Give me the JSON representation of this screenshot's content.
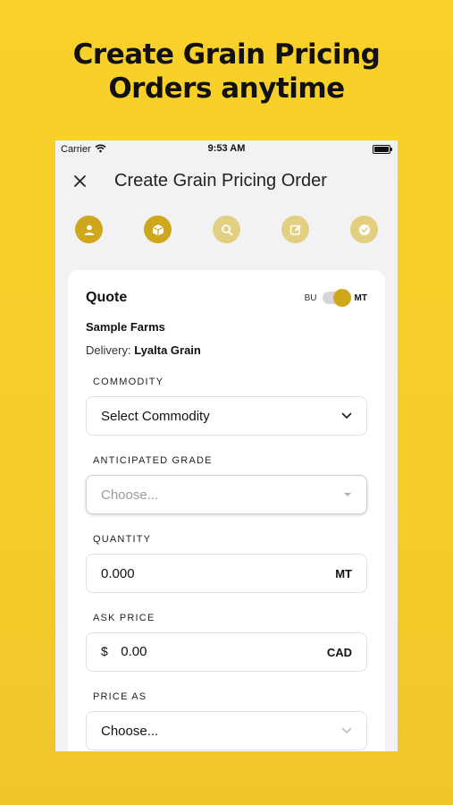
{
  "headline": {
    "line1": "Create Grain Pricing",
    "line2": "Orders anytime"
  },
  "status_bar": {
    "carrier": "Carrier",
    "time": "9:53 AM"
  },
  "navbar": {
    "title": "Create Grain Pricing Order",
    "close_icon": "close-icon"
  },
  "steps": [
    {
      "icon": "user-icon",
      "state": "active"
    },
    {
      "icon": "box-icon",
      "state": "active"
    },
    {
      "icon": "search-icon",
      "state": "inactive"
    },
    {
      "icon": "edit-icon",
      "state": "inactive"
    },
    {
      "icon": "check-circle-icon",
      "state": "inactive"
    }
  ],
  "quote": {
    "title": "Quote",
    "unit_left": "BU",
    "unit_right": "MT",
    "selected_unit": "MT",
    "farm": "Sample Farms",
    "delivery_label": "Delivery:",
    "delivery_value": "Lyalta Grain"
  },
  "form": {
    "commodity": {
      "label": "COMMODITY",
      "value": "Select Commodity"
    },
    "grade": {
      "label": "ANTICIPATED GRADE",
      "placeholder": "Choose..."
    },
    "quantity": {
      "label": "QUANTITY",
      "value": "0.000",
      "unit": "MT"
    },
    "ask_price": {
      "label": "ASK PRICE",
      "prefix": "$",
      "value": "0.00",
      "currency": "CAD"
    },
    "price_as": {
      "label": "PRICE AS",
      "value": "Choose..."
    }
  },
  "colors": {
    "accent": "#cfa71d",
    "accent_muted": "#e3cf82",
    "background": "#f9d12a"
  }
}
